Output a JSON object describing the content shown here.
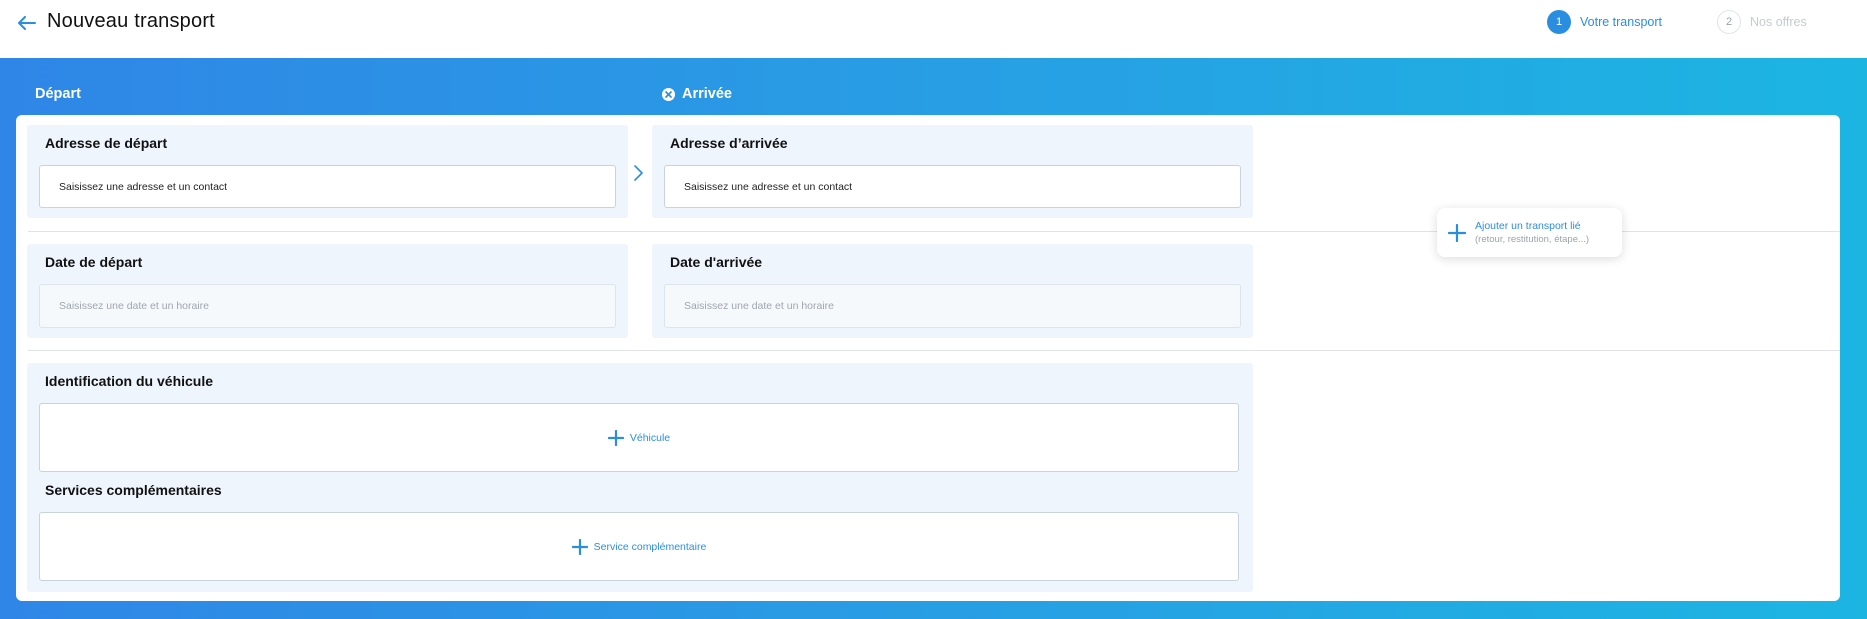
{
  "header": {
    "title": "Nouveau transport",
    "steps": [
      {
        "number": "1",
        "label": "Votre transport",
        "active": true
      },
      {
        "number": "2",
        "label": "Nos offres",
        "active": false
      }
    ]
  },
  "band": {
    "departure_label": "Départ",
    "arrival_label": "Arrivée"
  },
  "address": {
    "departure_title": "Adresse de départ",
    "departure_placeholder": "Saisissez une adresse et un contact",
    "arrival_title": "Adresse d’arrivée",
    "arrival_placeholder": "Saisissez une adresse et un contact"
  },
  "dates": {
    "departure_title": "Date de départ",
    "departure_placeholder": "Saisissez une date et un horaire",
    "arrival_title": "Date d'arrivée",
    "arrival_placeholder": "Saisissez une date et un horaire"
  },
  "vehicle": {
    "title": "Identification du véhicule",
    "add_label": "Véhicule"
  },
  "services": {
    "title": "Services complémentaires",
    "add_label": "Service complémentaire"
  },
  "linked_transport": {
    "label": "Ajouter un transport lié",
    "hint": "(retour, restitution, étape...)"
  },
  "colors": {
    "accent": "#2a8ee0",
    "band_start": "#2f86e6",
    "band_end": "#1cb5e2",
    "section_bg": "#eef5fd"
  },
  "icons": {
    "back": "arrow-left-icon",
    "clear": "close-circle-icon",
    "next": "chevron-right-icon",
    "add": "plus-icon"
  }
}
